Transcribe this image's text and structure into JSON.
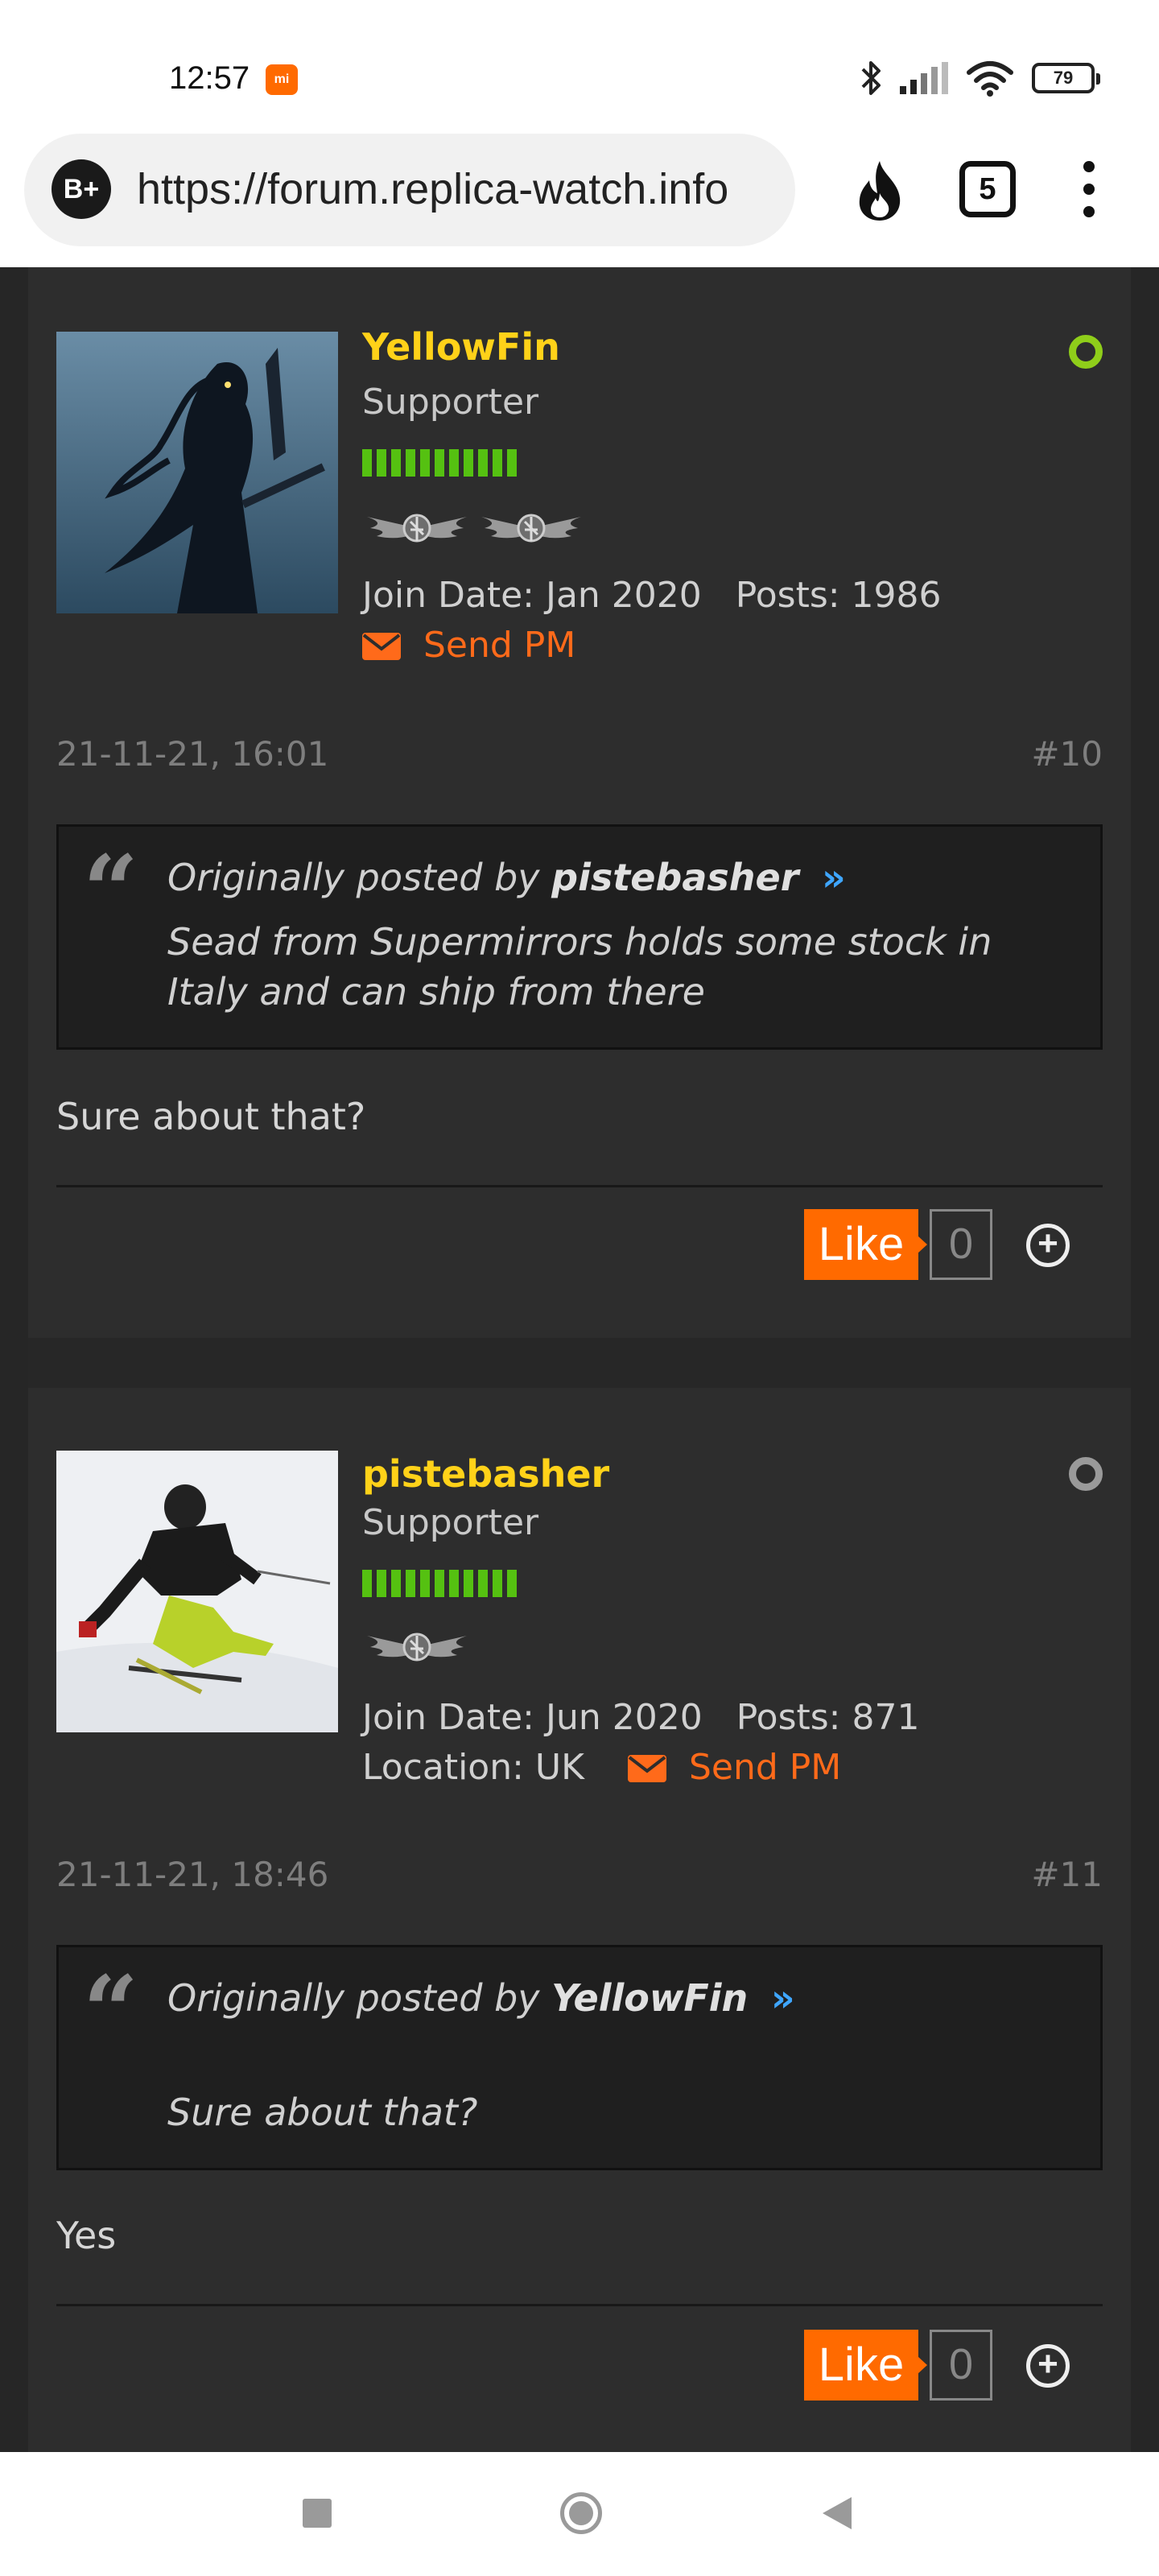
{
  "status_bar": {
    "time": "12:57",
    "mi_badge": "mi",
    "battery": "79"
  },
  "browser": {
    "site_icon": "B+",
    "url": "https://forum.replica-watch.info",
    "tab_count": "5",
    "icons": [
      "fire-icon",
      "tabs-icon",
      "more-vertical-icon"
    ]
  },
  "posts": [
    {
      "username": "YellowFin",
      "rank": "Supporter",
      "online": true,
      "join_date": "Join Date: Jan 2020",
      "posts": "Posts: 1986",
      "send_pm": "Send PM",
      "date": "21-11-21, 16:01",
      "number": "#10",
      "quote": {
        "prefix": "Originally posted by",
        "author": "pistebasher",
        "arrow": "»",
        "text": "Sead from Supermirrors holds some stock in Italy and can ship from there"
      },
      "message": "Sure about that?",
      "like_label": "Like",
      "like_count": "0"
    },
    {
      "username": "pistebasher",
      "rank": "Supporter",
      "online": false,
      "join_date": "Join Date: Jun 2020",
      "posts": "Posts: 871",
      "location": "Location: UK",
      "send_pm": "Send PM",
      "date": "21-11-21, 18:46",
      "number": "#11",
      "quote": {
        "prefix": "Originally posted by",
        "author": "YellowFin",
        "arrow": "»",
        "text": "Sure about that?"
      },
      "message": "Yes",
      "like_label": "Like",
      "like_count": "0"
    }
  ],
  "colors": {
    "username": "#ffd219",
    "accent": "#ff6a00",
    "reputation": "#55c111",
    "online": "#8fce1a",
    "offline": "#9a9a9a",
    "quote_link": "#3fa6ff"
  }
}
